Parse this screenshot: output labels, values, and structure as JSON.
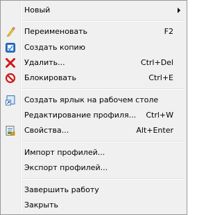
{
  "menu": {
    "new": {
      "label": "Новый",
      "has_submenu": true
    },
    "rename": {
      "label": "Переименовать",
      "shortcut": "F2",
      "icon": "pencil-icon"
    },
    "copy": {
      "label": "Создать копию",
      "icon": "copy-icon"
    },
    "delete": {
      "label": "Удалить...",
      "shortcut": "Ctrl+Del",
      "icon": "delete-x-icon"
    },
    "block": {
      "label": "Блокировать",
      "shortcut": "Ctrl+E",
      "icon": "block-icon"
    },
    "shortcut_desktop": {
      "label": "Создать ярлык на рабочем столе",
      "icon": "shortcut-icon"
    },
    "edit_profile": {
      "label": "Редактирование профиля...",
      "shortcut": "Ctrl+W"
    },
    "properties": {
      "label": "Свойства...",
      "shortcut": "Alt+Enter",
      "icon": "properties-icon"
    },
    "import": {
      "label": "Импорт профилей..."
    },
    "export": {
      "label": "Экспорт профилей..."
    },
    "shutdown": {
      "label": "Завершить работу"
    },
    "close": {
      "label": "Закрыть"
    }
  },
  "colors": {
    "menu_background": "#f0f0f0",
    "border": "#979797",
    "separator": "#e0e0e0"
  }
}
